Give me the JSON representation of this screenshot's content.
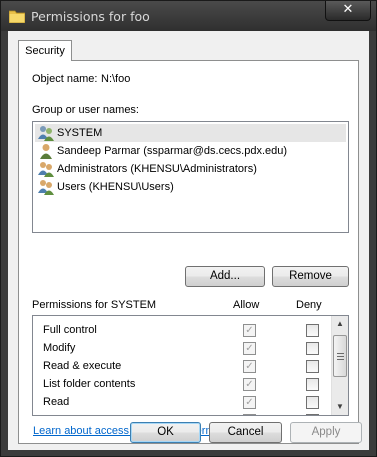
{
  "window": {
    "title": "Permissions for foo",
    "close_label": "✕"
  },
  "tabs": [
    {
      "label": "Security"
    }
  ],
  "object": {
    "label": "Object name:",
    "value": "N:\\foo"
  },
  "groups": {
    "label": "Group or user names:",
    "items": [
      {
        "name": "SYSTEM",
        "icon": "system-users-icon",
        "selected": true
      },
      {
        "name": "Sandeep Parmar (ssparmar@ds.cecs.pdx.edu)",
        "icon": "user-icon",
        "selected": false
      },
      {
        "name": "Administrators (KHENSU\\Administrators)",
        "icon": "group-users-icon",
        "selected": false
      },
      {
        "name": "Users (KHENSU\\Users)",
        "icon": "group-users-icon",
        "selected": false
      }
    ]
  },
  "buttons": {
    "add": "Add...",
    "remove": "Remove",
    "ok": "OK",
    "cancel": "Cancel",
    "apply": "Apply"
  },
  "permissions": {
    "label": "Permissions for SYSTEM",
    "allow_header": "Allow",
    "deny_header": "Deny",
    "rows": [
      {
        "name": "Full control",
        "allow": true,
        "deny": false
      },
      {
        "name": "Modify",
        "allow": true,
        "deny": false
      },
      {
        "name": "Read & execute",
        "allow": true,
        "deny": false
      },
      {
        "name": "List folder contents",
        "allow": true,
        "deny": false
      },
      {
        "name": "Read",
        "allow": true,
        "deny": false
      }
    ]
  },
  "link": "Learn about access control and permissions",
  "colors": {
    "link": "#0066cc",
    "frame": "#3b3b3b",
    "face": "#f0f0f0"
  }
}
